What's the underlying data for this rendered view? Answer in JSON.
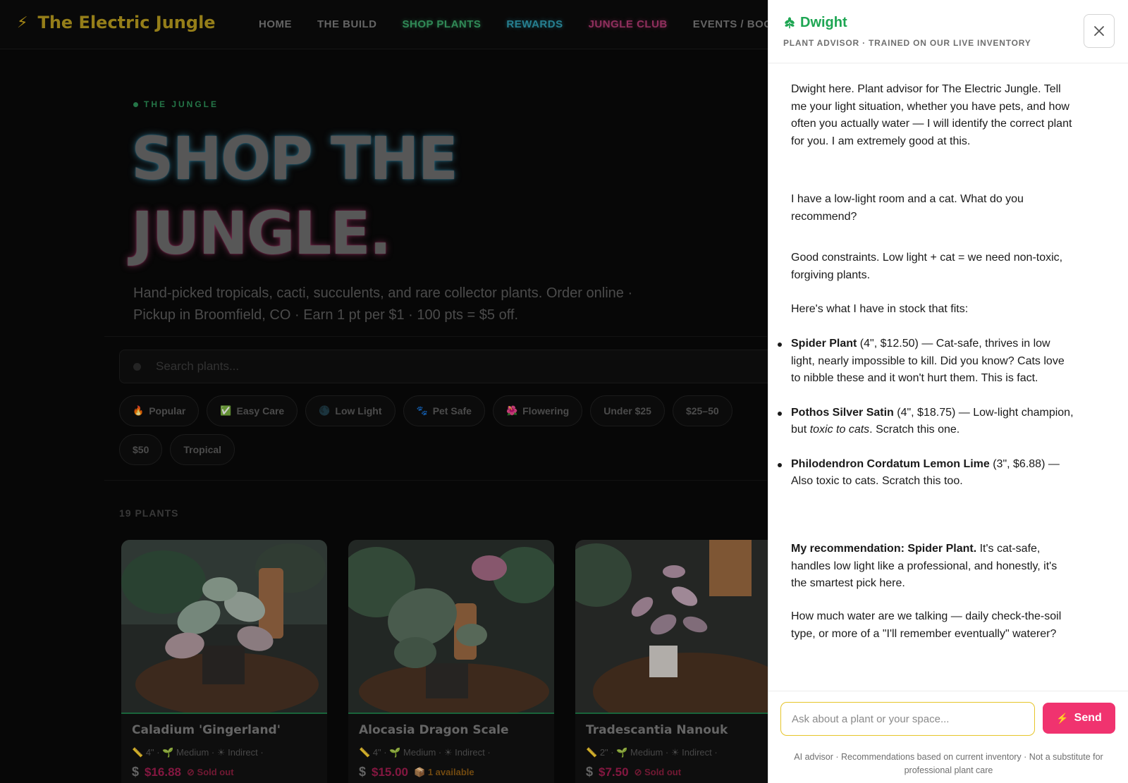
{
  "brand": {
    "name": "The Electric Jungle",
    "icon": "lightning-bolt-icon"
  },
  "nav": [
    "HOME",
    "THE BUILD",
    "SHOP PLANTS",
    "REWARDS",
    "JUNGLE CLUB",
    "EVENTS / BOOK"
  ],
  "hero": {
    "eyebrow": "THE JUNGLE",
    "line1": "SHOP THE",
    "line2": "JUNGLE.",
    "subtitle": "Hand-picked tropicals, cacti, succulents, and rare collector plants. Order online · Pickup in Broomfield, CO · Earn 1 pt per $1 · 100 pts = $5 off."
  },
  "search": {
    "placeholder": "Search plants..."
  },
  "filters": [
    {
      "icon": "🔥",
      "label": "Popular"
    },
    {
      "icon": "✅",
      "label": "Easy Care"
    },
    {
      "icon": "🌑",
      "label": "Low Light"
    },
    {
      "icon": "🐾",
      "label": "Pet Safe"
    },
    {
      "icon": "🌺",
      "label": "Flowering"
    },
    {
      "icon": "",
      "label": "Under $25"
    },
    {
      "icon": "",
      "label": "$25–50"
    },
    {
      "icon": "",
      "label": "$50"
    },
    {
      "icon": "",
      "label": "Tropical"
    }
  ],
  "results": {
    "count_label": "19 PLANTS"
  },
  "products": [
    {
      "name": "Caladium 'Gingerland'",
      "size": "4\"",
      "care": "Medium",
      "light": "Indirect",
      "price": "$16.88",
      "stock": "Sold out",
      "stock_type": "sold"
    },
    {
      "name": "Alocasia Dragon Scale",
      "size": "4\"",
      "care": "Medium",
      "light": "Indirect",
      "price": "$15.00",
      "stock": "1 available",
      "stock_type": "avail"
    },
    {
      "name": "Tradescantia Nanouk",
      "size": "2\"",
      "care": "Medium",
      "light": "Indirect",
      "price": "$7.50",
      "stock": "Sold out",
      "stock_type": "sold"
    }
  ],
  "chat": {
    "title": "Dwight",
    "subtitle": "PLANT ADVISOR · TRAINED ON OUR LIVE INVENTORY",
    "close_label": "×",
    "messages": {
      "greeting": "Dwight here. Plant advisor for The Electric Jungle. Tell me your light situation, whether you have pets, and how often you actually water — I will identify the correct plant for you. I am extremely good at this.",
      "user_question": "I have a low-light room and a cat. What do you recommend?",
      "reply_intro": "Good constraints. Low light + cat = we need non-toxic, forgiving plants.",
      "reply_lead": "Here's what I have in stock that fits:",
      "items": [
        {
          "name": "Spider Plant",
          "detail": " (4\", $12.50) — Cat-safe, thrives in low light, nearly impossible to kill. Did you know? Cats love to nibble these and it won't hurt them. This is fact."
        },
        {
          "name": "Pothos Silver Satin",
          "detail_a": " (4\", $18.75) — Low-light champion, but ",
          "detail_em": "toxic to cats",
          "detail_b": ". Scratch this one."
        },
        {
          "name": "Philodendron Cordatum Lemon Lime",
          "detail": " (3\", $6.88) — Also toxic to cats. Scratch this too."
        }
      ],
      "recommendation_bold": "My recommendation: Spider Plant.",
      "recommendation_rest": " It's cat-safe, handles low light like a professional, and honestly, it's the smartest pick here.",
      "followup": "How much water are we talking — daily check-the-soil type, or more of a \"I'll remember eventually\" waterer?"
    },
    "input_placeholder": "Ask about a plant or your space...",
    "send_label": "Send",
    "disclaimer": "AI advisor · Recommendations based on current inventory · Not a substitute for professional plant care"
  },
  "colors": {
    "accent_green": "#1ea653",
    "send_pink": "#f0336f",
    "input_border": "#e6c52a",
    "price_pink": "#a01d4f"
  }
}
